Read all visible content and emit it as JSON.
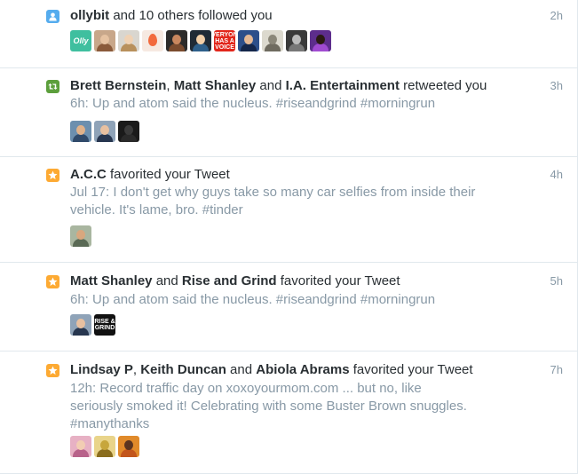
{
  "notifications": [
    {
      "type": "follow",
      "icon": "person-follow-icon",
      "icon_color": "#55acee",
      "names": [
        "ollybit"
      ],
      "joiners": [],
      "action": " and 10 others followed you",
      "time": "2h",
      "tweet": [],
      "avatars": [
        {
          "name": "olly-avatar",
          "bg": "#3fbf9f",
          "label": "Olly"
        },
        {
          "name": "avatar-2",
          "bg": "#c8a78a",
          "face": "#e6c2a1",
          "body": "#8a5a3a"
        },
        {
          "name": "avatar-3",
          "bg": "#d9d6cf",
          "face": "#f0d2b4",
          "body": "#b8905c"
        },
        {
          "name": "egg-avatar",
          "bg": "#f6e9e1",
          "egg": "#f26a3d"
        },
        {
          "name": "avatar-5",
          "bg": "#2c2b2a",
          "face": "#c9875e",
          "body": "#7a4b2e"
        },
        {
          "name": "avatar-6",
          "bg": "#1f2a35",
          "face": "#f2cfa8",
          "body": "#2e5f8a"
        },
        {
          "name": "everyone-avatar",
          "bg": "#e2261b",
          "label": "EVERYONE HAS A VOICE"
        },
        {
          "name": "avatar-8",
          "bg": "#2d4f8a",
          "face": "#e5b995",
          "body": "#14264a"
        },
        {
          "name": "avatar-9",
          "bg": "#dcd9ce",
          "face": "#8b8779",
          "body": "#6f6b5f"
        },
        {
          "name": "avatar-10",
          "bg": "#3a3a3a",
          "face": "#bbbbbb",
          "body": "#777777"
        },
        {
          "name": "avatar-11",
          "bg": "#5d2d8c",
          "face": "#2a1a12",
          "body": "#a04bd1"
        }
      ]
    },
    {
      "type": "retweet",
      "icon": "retweet-icon",
      "icon_color": "#5c9f3c",
      "names": [
        "Brett Bernstein",
        "Matt Shanley",
        "I.A. Entertainment"
      ],
      "joiners": [
        ", ",
        " and "
      ],
      "action": " retweeted you",
      "time": "3h",
      "tweet": [
        "6h: Up and atom said the nucleus. #riseandgrind #morningrun"
      ],
      "avatars": [
        {
          "name": "brett-avatar",
          "bg": "#6c8fae",
          "face": "#e0b28a",
          "body": "#304a6a"
        },
        {
          "name": "matt-avatar",
          "bg": "#8fa3b8",
          "face": "#e8c0a0",
          "body": "#27364f"
        },
        {
          "name": "ia-avatar",
          "bg": "#1a1a1a",
          "face": "#3a3a3a",
          "body": "#2a2a2a"
        }
      ]
    },
    {
      "type": "favorite",
      "icon": "star-icon",
      "icon_color": "#fdaa33",
      "names": [
        "A.C.C"
      ],
      "joiners": [],
      "action": " favorited your Tweet",
      "time": "4h",
      "tweet": [
        "Jul 17: I don't get why guys take so many car selfies from inside their",
        "vehicle. It's lame, bro. #tinder"
      ],
      "avatars": [
        {
          "name": "acc-avatar",
          "bg": "#a9b6a0",
          "face": "#d9a77e",
          "body": "#5a6a55"
        }
      ]
    },
    {
      "type": "favorite",
      "icon": "star-icon",
      "icon_color": "#fdaa33",
      "names": [
        "Matt Shanley",
        "Rise and Grind"
      ],
      "joiners": [
        " and "
      ],
      "action": " favorited your Tweet",
      "time": "5h",
      "tweet": [
        "6h: Up and atom said the nucleus. #riseandgrind #morningrun"
      ],
      "avatars": [
        {
          "name": "matt-avatar",
          "bg": "#8fa3b8",
          "face": "#e8c0a0",
          "body": "#27364f"
        },
        {
          "name": "rise-grind-avatar",
          "bg": "#111111",
          "label": "RISE & GRIND"
        }
      ]
    },
    {
      "type": "favorite",
      "icon": "star-icon",
      "icon_color": "#fdaa33",
      "names": [
        "Lindsay P",
        "Keith Duncan",
        "Abiola Abrams"
      ],
      "joiners": [
        ", ",
        " and "
      ],
      "action": " favorited your Tweet",
      "time": "7h",
      "tweet": [
        "12h: Record traffic day on xoxoyourmom.com ... but no, like",
        "seriously smoked it! Celebrating with some Buster Brown snuggles.",
        "#manythanks"
      ],
      "avatars": [
        {
          "name": "lindsay-avatar",
          "bg": "#e7b1c4",
          "face": "#f2cdb3",
          "body": "#b8628a"
        },
        {
          "name": "keith-avatar",
          "bg": "#e9d48a",
          "face": "#c7a63c",
          "body": "#8a6d1e"
        },
        {
          "name": "abiola-avatar",
          "bg": "#e08a2a",
          "face": "#5a3420",
          "body": "#c2551b"
        }
      ]
    }
  ]
}
